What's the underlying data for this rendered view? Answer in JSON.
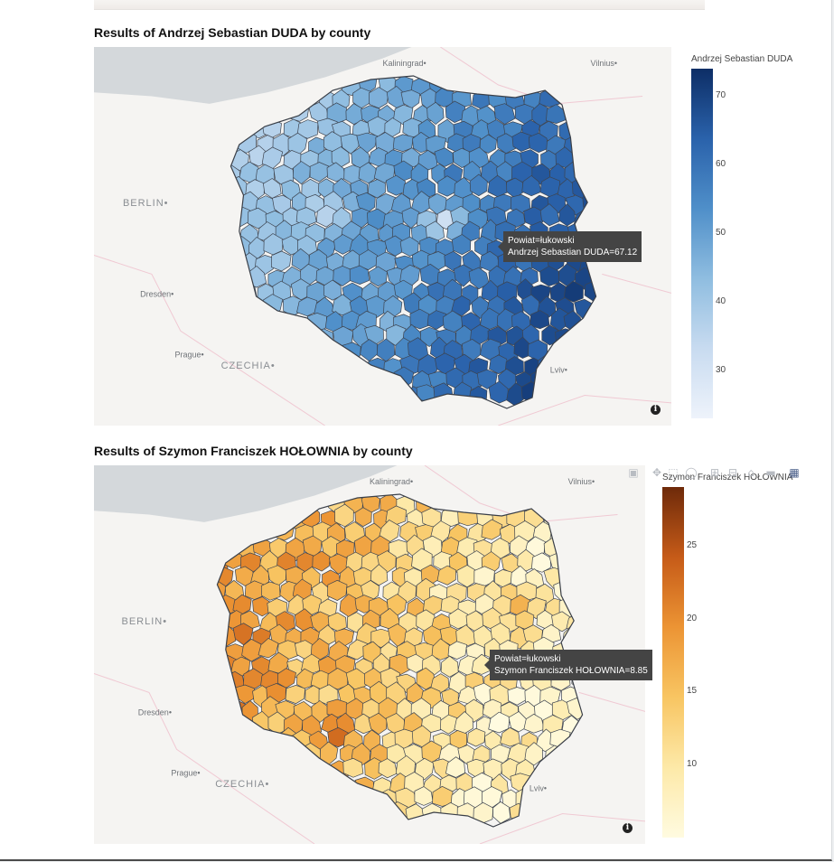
{
  "charts": [
    {
      "title": "Results of Andrzej Sebastian DUDA by county",
      "colorbar": {
        "title": "Andrzej Sebastian DUDA",
        "ticks": [
          "70",
          "60",
          "50",
          "40",
          "30"
        ],
        "tick_values": [
          70,
          60,
          50,
          40,
          30
        ],
        "range": [
          23,
          74
        ],
        "colors": [
          "#eef3fb",
          "#c8dbf0",
          "#8fbde0",
          "#4f8fc9",
          "#2a62ab",
          "#0d2e66"
        ]
      },
      "tooltip": {
        "line1": "Powiat=łukowski",
        "line2": "Andrzej Sebastian DUDA=67.12"
      },
      "cities": {
        "kaliningrad": "Kaliningrad",
        "vilnius": "Vilnius",
        "berlin": "BERLIN",
        "dresden": "Dresden",
        "prague": "Prague",
        "czechia": "CZECHIA",
        "lviv": "Lviv"
      }
    },
    {
      "title": "Results of Szymon Franciszek HOŁOWNIA by county",
      "colorbar": {
        "title": "Szymon Franciszek HOŁOWNIA",
        "ticks": [
          "25",
          "20",
          "15",
          "10"
        ],
        "tick_values": [
          25,
          20,
          15,
          10
        ],
        "range": [
          5,
          29
        ],
        "colors": [
          "#fffbe0",
          "#fde9a8",
          "#f8c562",
          "#ec9434",
          "#c65b18",
          "#6e2a0a"
        ]
      },
      "tooltip": {
        "line1": "Powiat=łukowski",
        "line2": "Szymon Franciszek HOŁOWNIA=8.85"
      },
      "cities": {
        "kaliningrad": "Kaliningrad",
        "vilnius": "Vilnius",
        "berlin": "BERLIN",
        "dresden": "Dresden",
        "prague": "Prague",
        "czechia": "CZECHIA",
        "lviv": "Lviv"
      }
    }
  ],
  "modebar": {
    "icons": [
      "camera-icon",
      "pan-icon",
      "box-select-icon",
      "lasso-icon",
      "zoom-in-icon",
      "zoom-out-icon",
      "reset-icon",
      "toggle-hover-icon",
      "plotly-logo-icon"
    ]
  }
}
